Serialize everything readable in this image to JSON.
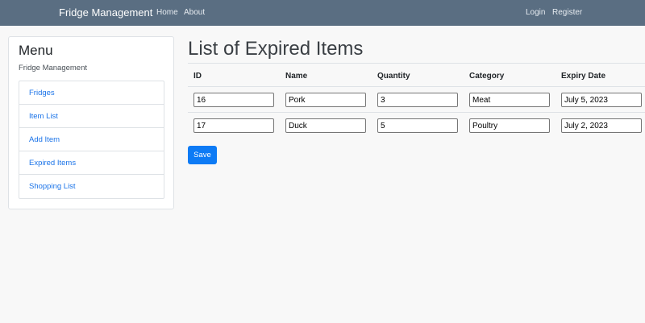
{
  "navbar": {
    "brand": "Fridge Management",
    "links": [
      "Home",
      "About"
    ],
    "auth": [
      "Login",
      "Register"
    ]
  },
  "sidebar": {
    "title": "Menu",
    "subtitle": "Fridge Management",
    "items": [
      {
        "label": "Fridges"
      },
      {
        "label": "Item List"
      },
      {
        "label": "Add Item"
      },
      {
        "label": "Expired Items"
      },
      {
        "label": "Shopping List"
      }
    ]
  },
  "main": {
    "title": "List of Expired Items",
    "columns": [
      "ID",
      "Name",
      "Quantity",
      "Category",
      "Expiry Date"
    ],
    "rows": [
      {
        "id": "16",
        "name": "Pork",
        "quantity": "3",
        "category": "Meat",
        "expiry": "July 5, 2023"
      },
      {
        "id": "17",
        "name": "Duck",
        "quantity": "5",
        "category": "Poultry",
        "expiry": "July 2, 2023"
      }
    ],
    "save_label": "Save"
  },
  "colors": {
    "navbar": "#5a6e82",
    "link": "#1a73e8",
    "primary_button": "#0d7bf5",
    "page_background": "#f8f8f8"
  }
}
